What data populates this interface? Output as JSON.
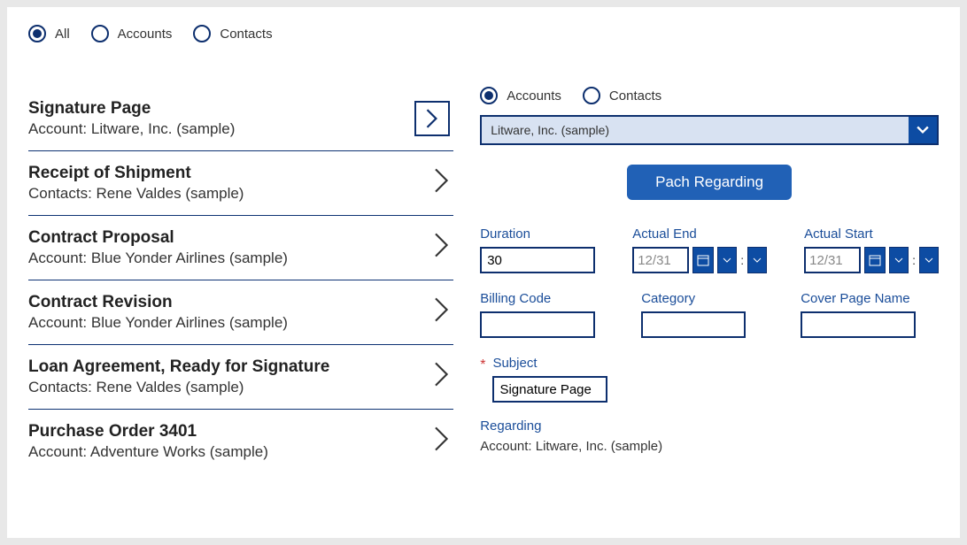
{
  "topFilters": [
    {
      "label": "All",
      "selected": true
    },
    {
      "label": "Accounts",
      "selected": false
    },
    {
      "label": "Contacts",
      "selected": false
    }
  ],
  "list": [
    {
      "title": "Signature Page",
      "subtitle": "Account: Litware, Inc. (sample)",
      "boxed": true
    },
    {
      "title": "Receipt of Shipment",
      "subtitle": "Contacts: Rene Valdes (sample)",
      "boxed": false
    },
    {
      "title": "Contract Proposal",
      "subtitle": "Account: Blue Yonder Airlines (sample)",
      "boxed": false
    },
    {
      "title": "Contract Revision",
      "subtitle": "Account: Blue Yonder Airlines (sample)",
      "boxed": false
    },
    {
      "title": "Loan Agreement, Ready for Signature",
      "subtitle": "Contacts: Rene Valdes (sample)",
      "boxed": false
    },
    {
      "title": "Purchase Order 3401",
      "subtitle": "Account: Adventure Works (sample)",
      "boxed": false
    }
  ],
  "subFilters": [
    {
      "label": "Accounts",
      "selected": true
    },
    {
      "label": "Contacts",
      "selected": false
    }
  ],
  "dropdown": {
    "value": "Litware, Inc. (sample)"
  },
  "primaryButton": "Pach Regarding",
  "fields": {
    "duration": {
      "label": "Duration",
      "value": "30"
    },
    "actualEnd": {
      "label": "Actual End",
      "value": "12/31"
    },
    "actualStart": {
      "label": "Actual Start",
      "value": "12/31"
    },
    "billingCode": {
      "label": "Billing Code",
      "value": ""
    },
    "category": {
      "label": "Category",
      "value": ""
    },
    "coverPageName": {
      "label": "Cover Page Name",
      "value": ""
    },
    "subject": {
      "label": "Subject",
      "value": "Signature Page"
    },
    "regarding": {
      "label": "Regarding",
      "value": "Account: Litware, Inc. (sample)"
    }
  }
}
